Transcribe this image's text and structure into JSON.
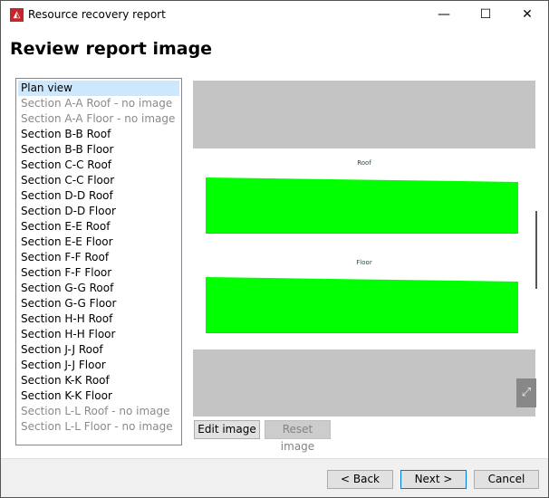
{
  "window": {
    "title": "Resource recovery report",
    "minimize": "—",
    "maximize": "☐",
    "close": "✕"
  },
  "heading": "Review report image",
  "list": [
    {
      "label": "Plan view",
      "state": "selected"
    },
    {
      "label": "Section A-A Roof - no image",
      "state": "disabled"
    },
    {
      "label": "Section A-A Floor - no image",
      "state": "disabled"
    },
    {
      "label": "Section B-B Roof",
      "state": "normal"
    },
    {
      "label": "Section B-B Floor",
      "state": "normal"
    },
    {
      "label": "Section C-C Roof",
      "state": "normal"
    },
    {
      "label": "Section C-C Floor",
      "state": "normal"
    },
    {
      "label": "Section D-D Roof",
      "state": "normal"
    },
    {
      "label": "Section D-D Floor",
      "state": "normal"
    },
    {
      "label": "Section E-E Roof",
      "state": "normal"
    },
    {
      "label": "Section E-E Floor",
      "state": "normal"
    },
    {
      "label": "Section F-F Roof",
      "state": "normal"
    },
    {
      "label": "Section F-F Floor",
      "state": "normal"
    },
    {
      "label": "Section G-G Roof",
      "state": "normal"
    },
    {
      "label": "Section G-G Floor",
      "state": "normal"
    },
    {
      "label": "Section H-H Roof",
      "state": "normal"
    },
    {
      "label": "Section H-H Floor",
      "state": "normal"
    },
    {
      "label": "Section J-J Roof",
      "state": "normal"
    },
    {
      "label": "Section J-J Floor",
      "state": "normal"
    },
    {
      "label": "Section K-K Roof",
      "state": "normal"
    },
    {
      "label": "Section K-K Floor",
      "state": "normal"
    },
    {
      "label": "Section L-L Roof - no image",
      "state": "disabled"
    },
    {
      "label": "Section L-L Floor - no image",
      "state": "disabled"
    }
  ],
  "preview": {
    "roof_title": "Roof",
    "floor_title": "Floor",
    "fill_color": "#00ff00"
  },
  "buttons": {
    "edit": "Edit image",
    "reset": "Reset image",
    "back": "< Back",
    "next": "Next >",
    "cancel": "Cancel"
  }
}
